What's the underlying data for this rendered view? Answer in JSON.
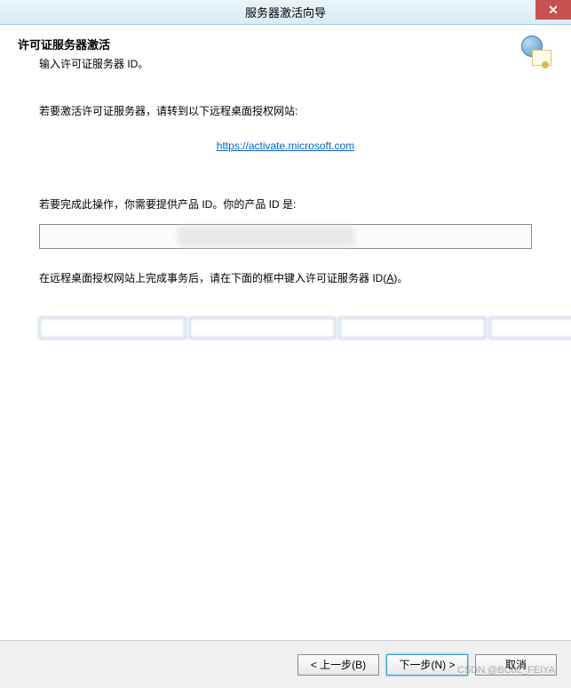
{
  "titlebar": {
    "title": "服务器激活向导",
    "close": "✕"
  },
  "header": {
    "heading": "许可证服务器激活",
    "subheading": "输入许可证服务器 ID。"
  },
  "body": {
    "instruction1": "若要激活许可证服务器，请转到以下远程桌面授权网站:",
    "link_text": "https://activate.microsoft.com",
    "product_label": "若要完成此操作，你需要提供产品 ID。你的产品 ID 是:",
    "after_label_pre": "在远程桌面授权网站上完成事务后，请在下面的框中键入许可证服务器 ID(",
    "after_label_key": "A",
    "after_label_post": ")。"
  },
  "id_fields": [
    "",
    "",
    "",
    "",
    "",
    "",
    ""
  ],
  "footer": {
    "back": "< 上一步(B)",
    "next": "下一步(N) >",
    "cancel": "取消"
  },
  "watermark": "CSDN @BC02_FEIYA"
}
